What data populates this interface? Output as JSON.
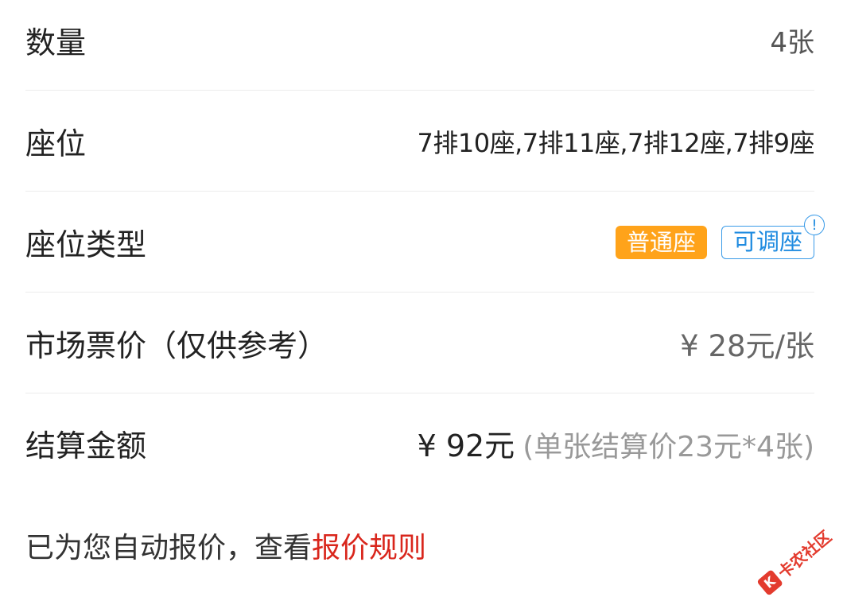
{
  "rows": {
    "quantity": {
      "label": "数量",
      "value": "4张"
    },
    "seats": {
      "label": "座位",
      "value": "7排10座,7排11座,7排12座,7排9座"
    },
    "seat_type": {
      "label": "座位类型",
      "tag_normal": "普通座",
      "tag_adjustable": "可调座",
      "info_glyph": "!"
    },
    "market_price": {
      "label": "市场票价（仅供参考）",
      "value": "¥ 28元/张"
    },
    "settlement": {
      "label": "结算金额",
      "amount": "¥ 92元",
      "detail": "(单张结算价23元*4张)"
    }
  },
  "footer": {
    "text": "已为您自动报价，查看",
    "link": "报价规则"
  },
  "watermark": {
    "text": "卡农社区"
  },
  "colors": {
    "tag_normal_bg": "#ffa31a",
    "tag_adjustable": "#1f8be0",
    "link": "#d9261c",
    "watermark": "#e33b2e"
  }
}
